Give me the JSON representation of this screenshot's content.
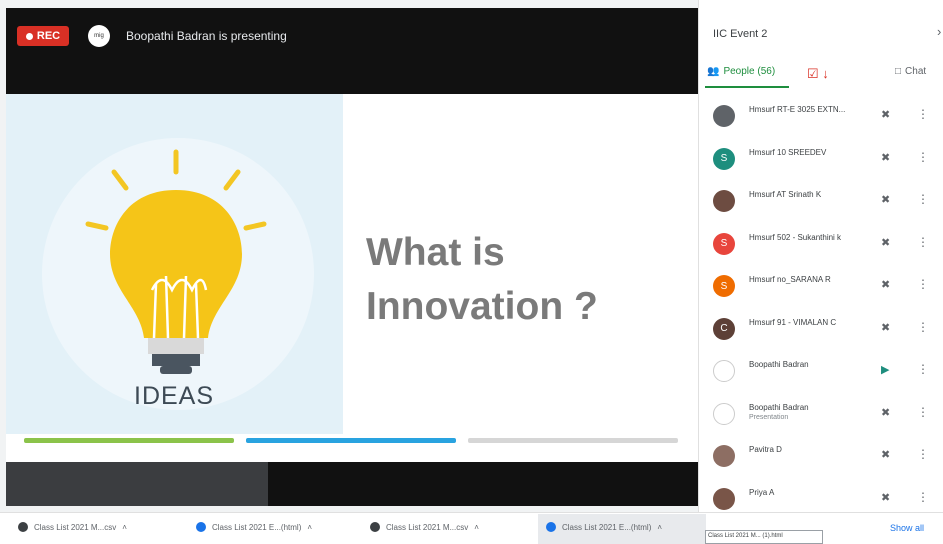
{
  "meeting": {
    "rec_label": "REC",
    "presenter_text": "Boopathi Badran is presenting",
    "avatar_text": "mig"
  },
  "slide": {
    "title_line1": "What is",
    "title_line2": "Innovation ?",
    "ideas_label": "IDEAS"
  },
  "sidebar": {
    "event_title": "IIC Event 2",
    "people_tab": "People (56)",
    "chat_tab": "Chat",
    "participants": [
      {
        "name": "Hmsurf RT-E 3025 EXTN...",
        "sub": "",
        "initial": "",
        "color": "#5f6368",
        "mic": "muted"
      },
      {
        "name": "Hmsurf 10 SREEDEV",
        "sub": "",
        "initial": "S",
        "color": "#1e8e7e",
        "mic": "muted"
      },
      {
        "name": "Hmsurf AT Srinath K",
        "sub": "",
        "initial": "",
        "color": "#6d4c41",
        "mic": "muted"
      },
      {
        "name": "Hmsurf 502 - Sukanthini k",
        "sub": "",
        "initial": "S",
        "color": "#e8453c",
        "mic": "muted"
      },
      {
        "name": "Hmsurf no_SARANA R",
        "sub": "",
        "initial": "S",
        "color": "#ef6c00",
        "mic": "muted"
      },
      {
        "name": "Hmsurf 91 - VIMALAN C",
        "sub": "",
        "initial": "C",
        "color": "#5d4037",
        "mic": "muted"
      },
      {
        "name": "Boopathi Badran",
        "sub": "",
        "initial": "",
        "color": "#ffffff",
        "mic": "active"
      },
      {
        "name": "Boopathi Badran",
        "sub": "Presentation",
        "initial": "",
        "color": "#ffffff",
        "mic": "muted"
      },
      {
        "name": "Pavitra D",
        "sub": "",
        "initial": "",
        "color": "#8d6e63",
        "mic": "muted"
      },
      {
        "name": "Priya A",
        "sub": "",
        "initial": "",
        "color": "#795548",
        "mic": "muted"
      }
    ]
  },
  "downloads": {
    "items": [
      {
        "name": "Class List 2021 M...csv",
        "color": "#3c4043"
      },
      {
        "name": "Class List 2021 E...(html)",
        "color": "#1a73e8"
      },
      {
        "name": "Class List 2021 M...csv",
        "color": "#3c4043"
      },
      {
        "name": "Class List 2021 E...(html)",
        "color": "#1a73e8"
      }
    ],
    "show_all": "Show all",
    "tooltip": "Class List 2021 M... (1).html"
  },
  "colors": {
    "accent": "#1e8e3e",
    "rec": "#d93025",
    "bar_green": "#8bc34a",
    "bar_blue": "#29a3e0",
    "bar_gray": "#d6d6d6"
  }
}
